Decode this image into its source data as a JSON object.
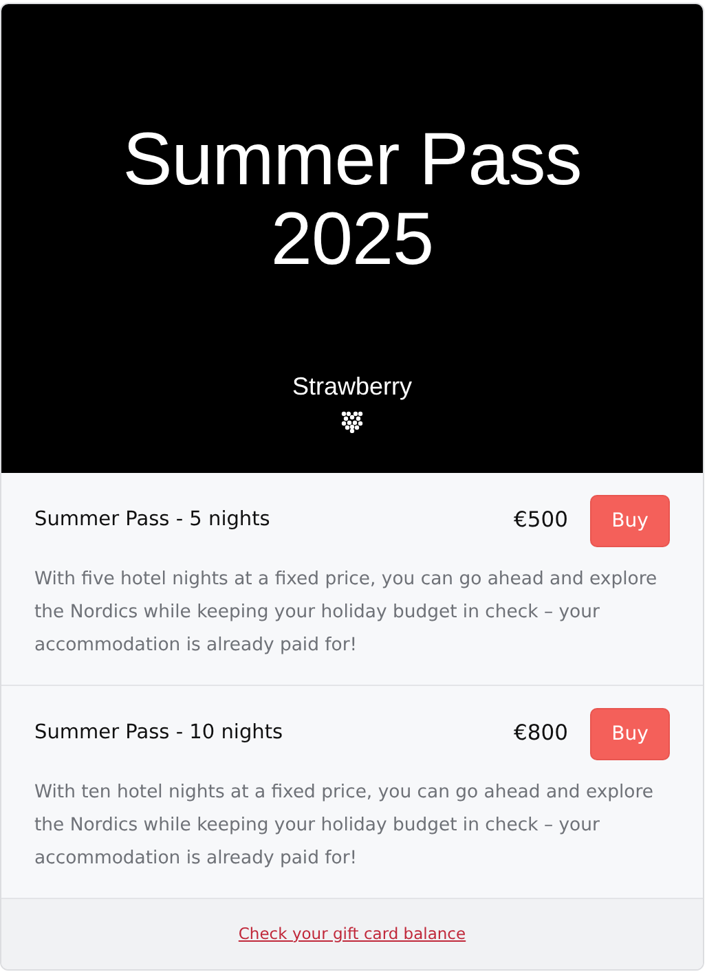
{
  "banner": {
    "title": "Summer Pass 2025",
    "brand": "Strawberry"
  },
  "products": [
    {
      "name": "Summer Pass - 5 nights",
      "price": "€500",
      "button": "Buy",
      "description": "With five hotel nights at a fixed price, you can go ahead and explore the Nordics while keeping your holiday budget in check – your accommodation is already paid for!"
    },
    {
      "name": "Summer Pass - 10 nights",
      "price": "€800",
      "button": "Buy",
      "description": "With ten hotel nights at a fixed price, you can go ahead and explore the Nordics while keeping your holiday budget in check – your accommodation is already paid for!"
    }
  ],
  "footer": {
    "link": "Check your gift card balance"
  }
}
